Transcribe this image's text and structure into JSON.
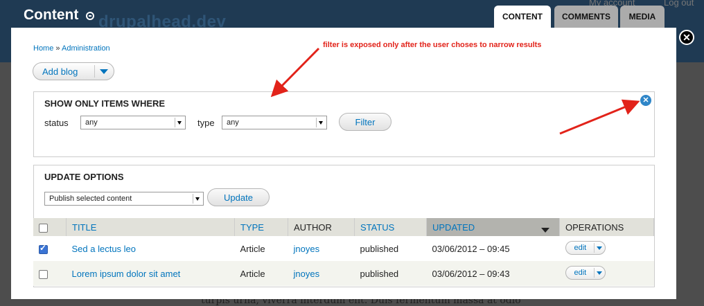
{
  "header": {
    "title": "Content",
    "site_name": "drupalhead.dev",
    "account_link": "My account",
    "logout_link": "Log out",
    "tabs": [
      {
        "label": "CONTENT",
        "active": true
      },
      {
        "label": "COMMENTS",
        "active": false
      },
      {
        "label": "MEDIA",
        "active": false
      }
    ]
  },
  "background_text": "turpis urna, viverra interdum elit. Duis fermentum massa at odio",
  "overlay": {
    "close_symbol": "✕",
    "breadcrumb": {
      "home": "Home",
      "separator": "»",
      "admin": "Administration"
    },
    "annotation": "filter is exposed only after the user choses to narrow results",
    "add_button": "Add blog",
    "filter": {
      "legend": "SHOW ONLY ITEMS WHERE",
      "status_label": "status",
      "status_value": "any",
      "type_label": "type",
      "type_value": "any",
      "button": "Filter",
      "close_symbol": "✕"
    },
    "update": {
      "legend": "UPDATE OPTIONS",
      "action_value": "Publish selected content",
      "button": "Update"
    },
    "table": {
      "columns": [
        "TITLE",
        "TYPE",
        "AUTHOR",
        "STATUS",
        "UPDATED",
        "OPERATIONS"
      ],
      "rows": [
        {
          "checked": true,
          "title": "Sed a lectus leo",
          "type": "Article",
          "author": "jnoyes",
          "status": "published",
          "updated": "03/06/2012 – 09:45",
          "op": "edit"
        },
        {
          "checked": false,
          "title": "Lorem ipsum dolor sit amet",
          "type": "Article",
          "author": "jnoyes",
          "status": "published",
          "updated": "03/06/2012 – 09:43",
          "op": "edit"
        }
      ]
    }
  },
  "colors": {
    "link": "#0074bd",
    "header_bg": "#1f3a53",
    "annotation": "#e2231a"
  }
}
